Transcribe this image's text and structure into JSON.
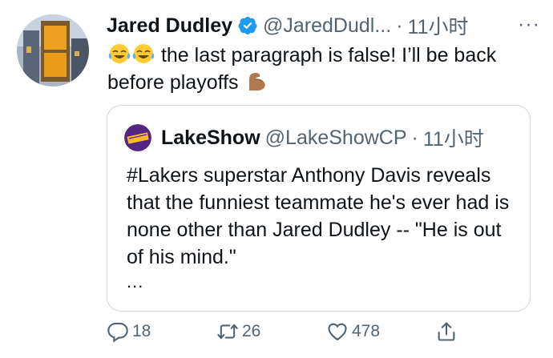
{
  "author": {
    "name": "Jared Dudley",
    "handle": "@JaredDudl...",
    "separator": "·",
    "time": "11小时",
    "more": "···"
  },
  "tweet": {
    "text": "the last paragraph is false! I’ll be back before playoffs"
  },
  "quoted": {
    "name": "LakeShow",
    "handle": "@LakeShowCP",
    "separator": "·",
    "time": "11小时",
    "text": "#Lakers superstar Anthony Davis reveals that the funniest teammate he's ever had is none other than Jared Dudley -- \"He is out of his mind.\"",
    "more": "..."
  },
  "actions": {
    "reply_count": "18",
    "retweet_count": "26",
    "like_count": "478"
  },
  "colors": {
    "text": "#0f1419",
    "secondary": "#536471",
    "verified": "#1d9bf0",
    "border": "#cfd9de"
  },
  "icons": {
    "verified": "verified-badge-icon",
    "reply": "reply-icon",
    "retweet": "retweet-icon",
    "like": "heart-icon",
    "share": "share-icon"
  }
}
